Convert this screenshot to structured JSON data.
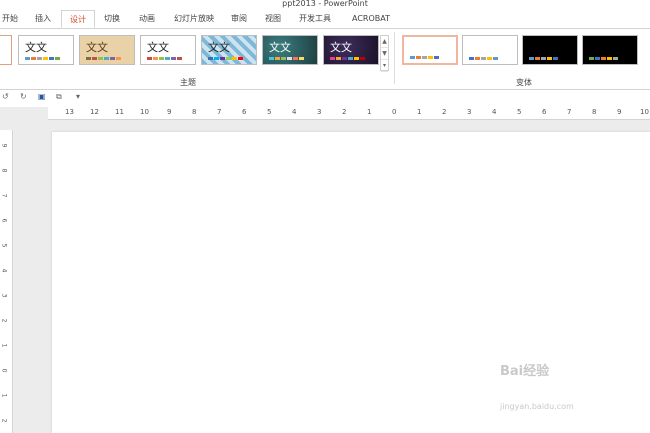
{
  "app": {
    "title": "ppt2013 - PowerPoint"
  },
  "tabs": [
    {
      "label": "开始"
    },
    {
      "label": "插入"
    },
    {
      "label": "设计",
      "active": true
    },
    {
      "label": "切换"
    },
    {
      "label": "动画"
    },
    {
      "label": "幻灯片放映"
    },
    {
      "label": "审阅"
    },
    {
      "label": "视图"
    },
    {
      "label": "开发工具"
    },
    {
      "label": "ACROBAT"
    }
  ],
  "themes": {
    "group_label": "主题",
    "items": [
      {
        "text": "文文",
        "bg": "#ffffff"
      },
      {
        "text": "文文",
        "bg": "#e9d1a8"
      },
      {
        "text": "文文",
        "bg": "#ffffff"
      },
      {
        "text": "文文",
        "bg": "#7fb7d6"
      },
      {
        "text": "文文",
        "bg": "#2c5a5d"
      },
      {
        "text": "文文",
        "bg": "#2d1f3f"
      }
    ]
  },
  "variants": {
    "group_label": "变体",
    "items": [
      {
        "bg": "#ffffff"
      },
      {
        "bg": "#ffffff"
      },
      {
        "bg": "#000000"
      },
      {
        "bg": "#000000"
      }
    ]
  },
  "qat": {
    "undo_icon": "↺",
    "redo_icon": "↻",
    "save_icon": "▣",
    "copy_icon": "⧉",
    "more_icon": "▾"
  },
  "hruler_labels": [
    "13",
    "12",
    "11",
    "10",
    "9",
    "8",
    "7",
    "6",
    "5",
    "4",
    "3",
    "2",
    "1",
    "0",
    "1",
    "2",
    "3",
    "4",
    "5",
    "6",
    "7",
    "8",
    "9",
    "10"
  ],
  "vruler_labels": [
    "9",
    "8",
    "7",
    "6",
    "5",
    "4",
    "3",
    "2",
    "1",
    "0",
    "1",
    "2"
  ],
  "watermark": {
    "brand": "Bai经验",
    "url": "jingyan.baidu.com"
  },
  "colors": {
    "active_tab": "#d24726",
    "canvas": "#ececec"
  }
}
